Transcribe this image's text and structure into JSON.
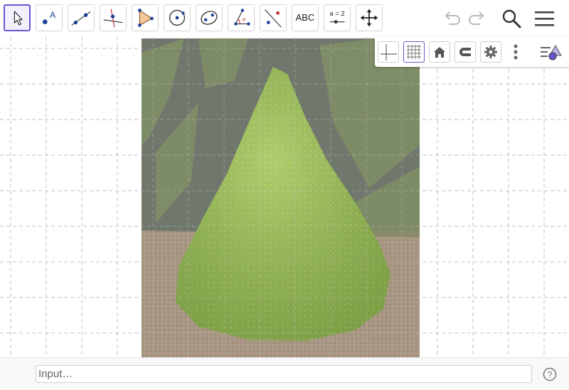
{
  "toolbar": {
    "tools": [
      {
        "id": "move",
        "icon": "cursor-arrow-icon",
        "active": true
      },
      {
        "id": "point",
        "icon": "point-icon",
        "label": "A"
      },
      {
        "id": "line",
        "icon": "line-through-two-points-icon"
      },
      {
        "id": "perpendicular",
        "icon": "perpendicular-line-icon"
      },
      {
        "id": "polygon",
        "icon": "polygon-icon"
      },
      {
        "id": "circle",
        "icon": "circle-center-point-icon"
      },
      {
        "id": "ellipse",
        "icon": "ellipse-icon"
      },
      {
        "id": "angle",
        "icon": "angle-icon",
        "label": "α"
      },
      {
        "id": "reflect",
        "icon": "reflect-about-line-icon"
      },
      {
        "id": "text",
        "icon": "text-icon",
        "label": "ABC"
      },
      {
        "id": "slider",
        "icon": "slider-icon",
        "label": "a = 2"
      },
      {
        "id": "move-view",
        "icon": "move-graphics-view-icon"
      }
    ],
    "undo_icon": "undo-icon",
    "redo_icon": "redo-icon",
    "search_icon": "search-icon",
    "menu_icon": "hamburger-menu-icon"
  },
  "style_bar": {
    "buttons": [
      {
        "id": "axes",
        "icon": "axes-icon"
      },
      {
        "id": "grid",
        "icon": "grid-icon",
        "active": true
      },
      {
        "id": "home",
        "icon": "home-icon"
      },
      {
        "id": "point-capture",
        "icon": "magnet-icon"
      },
      {
        "id": "settings",
        "icon": "gear-icon"
      },
      {
        "id": "more",
        "icon": "more-vertical-icon"
      },
      {
        "id": "toggle-views",
        "icon": "views-toggle-icon"
      }
    ]
  },
  "input_bar": {
    "placeholder": "Input…",
    "help_icon": "help-icon",
    "help_label": "?"
  },
  "colors": {
    "accent": "#6557d2",
    "grid": "#c0c0c0"
  }
}
